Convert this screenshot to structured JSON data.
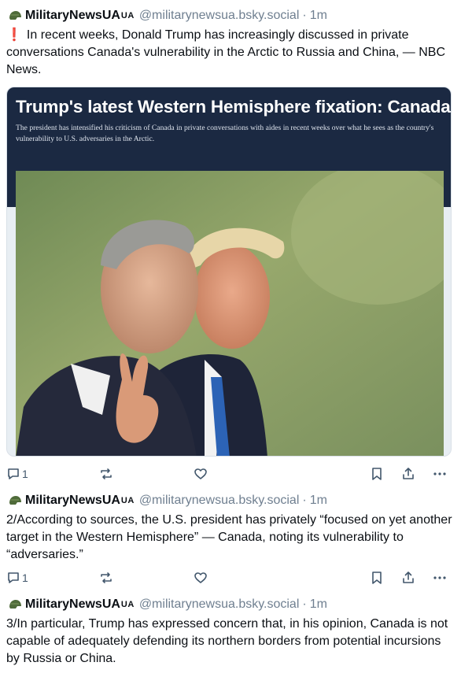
{
  "posts": [
    {
      "author": "MilitaryNewsUA",
      "author_flag": "UA",
      "handle": "@militarynewsua.bsky.social",
      "separator": "·",
      "time": "1m",
      "alert": "❗",
      "text": "In recent weeks, Donald Trump has increasingly discussed in private conversations Canada's vulnerability in the Arctic to Russia and China, — NBC News.",
      "embed": {
        "title": "Trump's latest Western Hemisphere fixation: Canada",
        "subtitle": "The president has intensified his criticism of Canada in private conversations with aides in recent weeks over what he sees as the country's vulnerability to U.S. adversaries in the Arctic."
      },
      "reply_count": "1"
    },
    {
      "author": "MilitaryNewsUA",
      "author_flag": "UA",
      "handle": "@militarynewsua.bsky.social",
      "separator": "·",
      "time": "1m",
      "text": "2/According to sources, the U.S. president has privately “focused on yet another target in the Western Hemisphere” — Canada, noting its vulnerability to “adversaries.”",
      "reply_count": "1"
    },
    {
      "author": "MilitaryNewsUA",
      "author_flag": "UA",
      "handle": "@militarynewsua.bsky.social",
      "separator": "·",
      "time": "1m",
      "text": "3/In particular, Trump has expressed concern that, in his opinion, Canada is not capable of adequately defending its northern borders from potential incursions by Russia or China."
    }
  ],
  "icons": {
    "avatar": "helmet-icon",
    "reply": "reply-icon",
    "repost": "repost-icon",
    "like": "heart-icon",
    "bookmark": "bookmark-icon",
    "share": "share-icon",
    "more": "more-icon"
  },
  "colors": {
    "text": "#0b0f14",
    "muted": "#6f7f90",
    "alert": "#e0245e",
    "banner": "#1b2942"
  }
}
